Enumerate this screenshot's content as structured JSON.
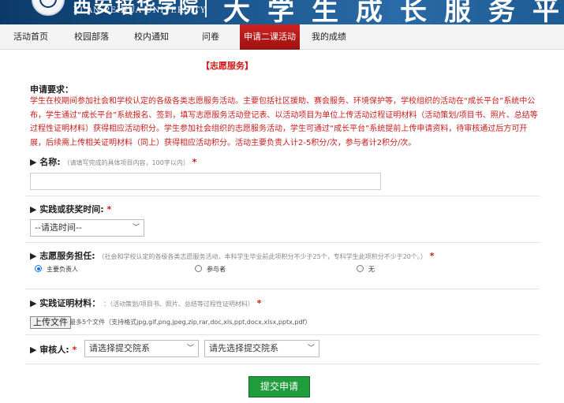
{
  "header": {
    "school_name_cn": "西安培华学院",
    "school_name_en": "XI'AN PEIHUA UNIVERSITY",
    "platform_title": "大学生成长服务平台"
  },
  "nav": {
    "items": [
      {
        "label": "活动首页"
      },
      {
        "label": "校园部落"
      },
      {
        "label": "校内通知"
      },
      {
        "label": "问卷"
      },
      {
        "label": "申请二课活动积",
        "active": true
      },
      {
        "label": "我的成绩"
      }
    ]
  },
  "form": {
    "section_title": "【志愿服务】",
    "requirements_title": "申请要求：",
    "requirements_text": "学生在校期间参加社会和学校认定的各级各类志愿服务活动。主要包括社区援助、赛会服务、环境保护等，学校组织的活动在“成长平台”系统中公布，学生通过“成长平台”系统报名、签到，填写志愿服务活动登记表、以活动项目为单位上传活动过程证明材料（活动策划/项目书、照片、总结等过程性证明材料）获得相应活动积分。学生参加社会组织的志愿服务活动，学生可通过“成长平台”系统提前上传申请资料，待审核通过后方可开展，后续需上传相关证明材料（同上）获得相应活动积分。活动主要负责人计2-5积分/次，参与者计2积分/次。",
    "name": {
      "label": "名称:",
      "hint": "（请填写完成的具体项目内容，100字以内）",
      "star": "*",
      "value": ""
    },
    "time": {
      "label": "实践或获奖时间:",
      "star": "*",
      "select_value": "--请选时间--"
    },
    "role": {
      "label": "志愿服务担任:",
      "hint": "（社会和学校认定的各级各类志愿服务活动，本科学生毕业前此项积分不少于25个，专科学生此项积分不少于20个。）",
      "star": "*",
      "options": [
        {
          "label": "主要负责人",
          "checked": true
        },
        {
          "label": "参与者",
          "checked": false
        },
        {
          "label": "无",
          "checked": false
        }
      ]
    },
    "proof": {
      "label": "实践证明材料：",
      "hint": "：（活动策划/项目书、照片、总结等过程性证明材料）",
      "star": "*",
      "upload_label": "上传文件",
      "upload_hint": "最多5个文件（支持格式jpg,gif,png,jpeg,zip,rar,doc,xls,ppt,docx,xlsx,pptx,pdf）"
    },
    "reviewer": {
      "label": "审核人:",
      "star": "*",
      "select1_value": "请选择提交院系",
      "select2_value": "请先选择提交院系"
    },
    "submit_label": "提交申请"
  },
  "colors": {
    "banner": "#1d5a92",
    "active_tab": "#b81818",
    "required_text": "#c81c1c",
    "submit": "#1f9c3c",
    "radio_checked": "#1a73e8"
  }
}
